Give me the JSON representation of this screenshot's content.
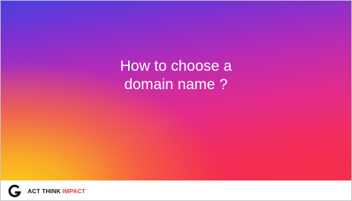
{
  "slide": {
    "title_lines": [
      "How to choose a",
      "domain name ?"
    ]
  },
  "footer": {
    "brand_part1": "ACT THINK ",
    "brand_part2": "IMPACT",
    "logo_icon": "g-logo-icon",
    "accent_color": "#e5322d"
  },
  "colors": {
    "gradient_top": "#4a3fe0",
    "gradient_mid": "#e02b8e",
    "gradient_bottom_left": "#fcd11c",
    "gradient_bottom_right": "#f42f4c"
  }
}
